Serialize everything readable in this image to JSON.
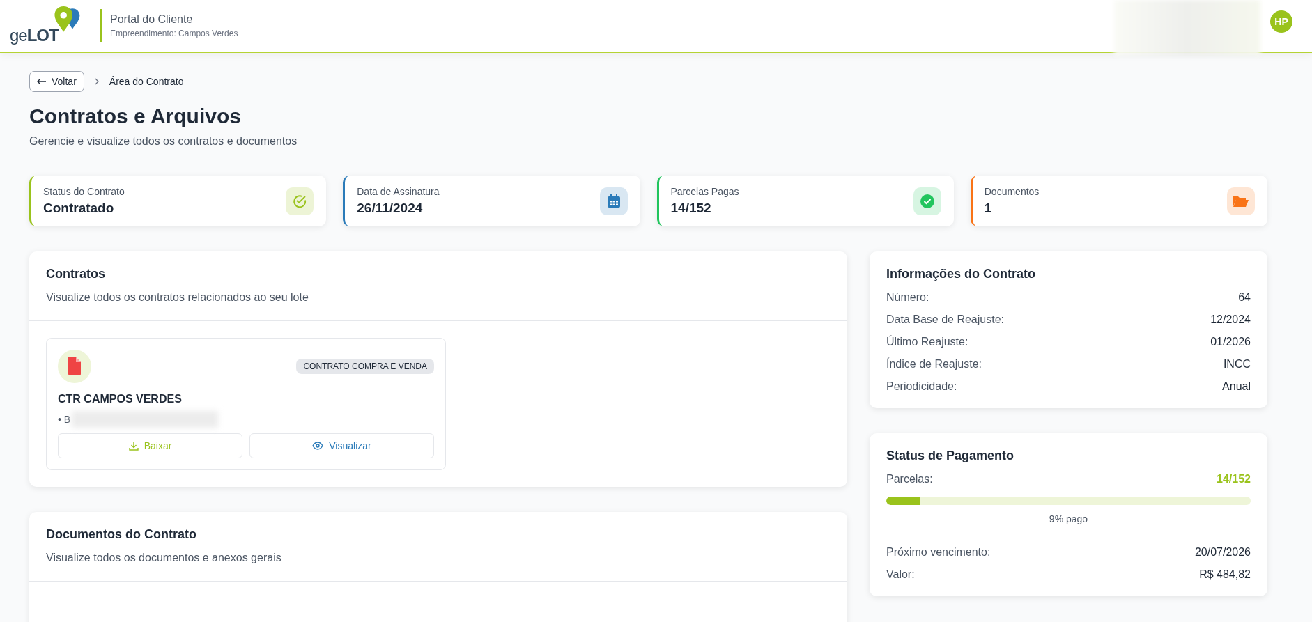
{
  "header": {
    "logo": {
      "text_plain": "ge",
      "text_bold": "LOT"
    },
    "title": "Portal do Cliente",
    "subtitle": "Empreendimento: Campos Verdes",
    "avatar": "HP"
  },
  "breadcrumb": {
    "back": "Voltar",
    "current": "Área do Contrato"
  },
  "page": {
    "title": "Contratos e Arquivos",
    "subtitle": "Gerencie e visualize todos os contratos e documentos"
  },
  "stats": [
    {
      "label": "Status do Contrato",
      "value": "Contratado",
      "kind": "check-outline",
      "color": "#9ac31c"
    },
    {
      "label": "Data de Assinatura",
      "value": "26/11/2024",
      "kind": "calendar",
      "color": "#2b7bb9"
    },
    {
      "label": "Parcelas Pagas",
      "value": "14/152",
      "kind": "check-filled",
      "color": "#22c55e"
    },
    {
      "label": "Documentos",
      "value": "1",
      "kind": "folder",
      "color": "#f97316"
    }
  ],
  "contracts": {
    "title": "Contratos",
    "subtitle": "Visualize todos os contratos relacionados ao seu lote",
    "items": [
      {
        "tag": "CONTRATO COMPRA E VENDA",
        "name": "CTR CAMPOS VERDES",
        "detail": "• B",
        "download": "Baixar",
        "view": "Visualizar"
      }
    ]
  },
  "documents": {
    "title": "Documentos do Contrato",
    "subtitle": "Visualize todos os documentos e anexos gerais"
  },
  "contract_info": {
    "title": "Informações do Contrato",
    "rows": [
      {
        "label": "Número:",
        "value": "64"
      },
      {
        "label": "Data Base de Reajuste:",
        "value": "12/2024"
      },
      {
        "label": "Último Reajuste:",
        "value": "01/2026"
      },
      {
        "label": "Índice de Reajuste:",
        "value": "INCC"
      },
      {
        "label": "Periodicidade:",
        "value": "Anual"
      }
    ]
  },
  "payment": {
    "title": "Status de Pagamento",
    "label": "Parcelas:",
    "value": "14/152",
    "level": 0.092,
    "percent": "9% pago",
    "rows": [
      {
        "label": "Próximo vencimento:",
        "value": "20/07/2026"
      },
      {
        "label": "Valor:",
        "value": "R$ 484,82"
      }
    ]
  }
}
